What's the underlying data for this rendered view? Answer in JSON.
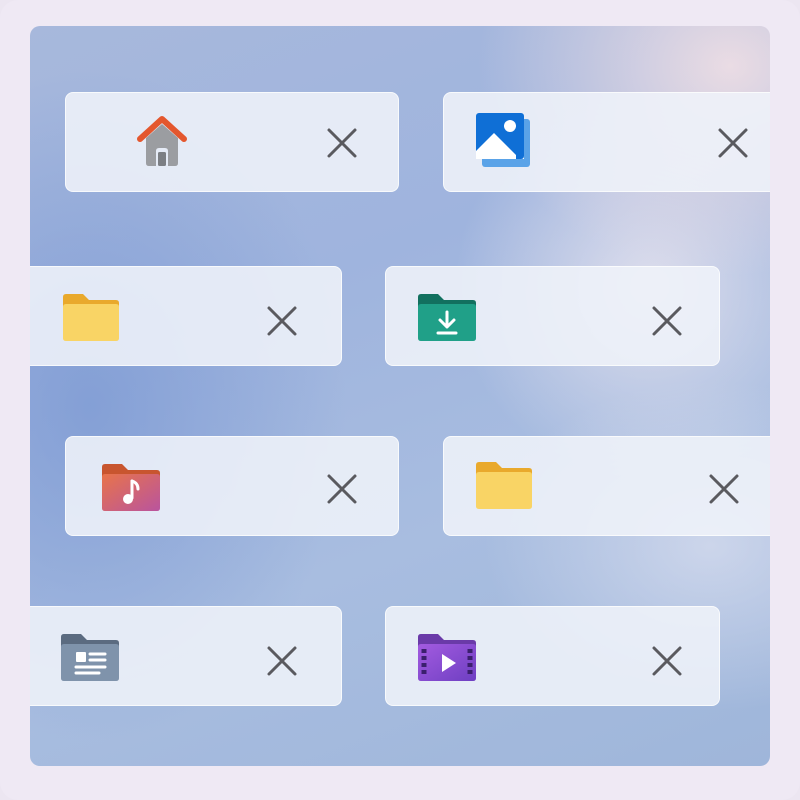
{
  "tabs": [
    {
      "id": "home",
      "icon": "home-icon",
      "close_icon": "close-icon"
    },
    {
      "id": "pictures",
      "icon": "pictures-icon",
      "close_icon": "close-icon"
    },
    {
      "id": "folder-1",
      "icon": "folder-icon",
      "close_icon": "close-icon"
    },
    {
      "id": "downloads",
      "icon": "downloads-folder-icon",
      "close_icon": "close-icon"
    },
    {
      "id": "music",
      "icon": "music-folder-icon",
      "close_icon": "close-icon"
    },
    {
      "id": "folder-2",
      "icon": "folder-icon",
      "close_icon": "close-icon"
    },
    {
      "id": "documents",
      "icon": "documents-folder-icon",
      "close_icon": "close-icon"
    },
    {
      "id": "videos",
      "icon": "videos-folder-icon",
      "close_icon": "close-icon"
    }
  ],
  "colors": {
    "tab_background": "#eff2f9",
    "close_glyph": "#5a5a5f",
    "folder_yellow": "#f7cf55",
    "downloads_teal": "#1f9e87",
    "music_orange": "#e0694c",
    "videos_purple": "#8b4fcf",
    "home_roof": "#e4572e"
  }
}
